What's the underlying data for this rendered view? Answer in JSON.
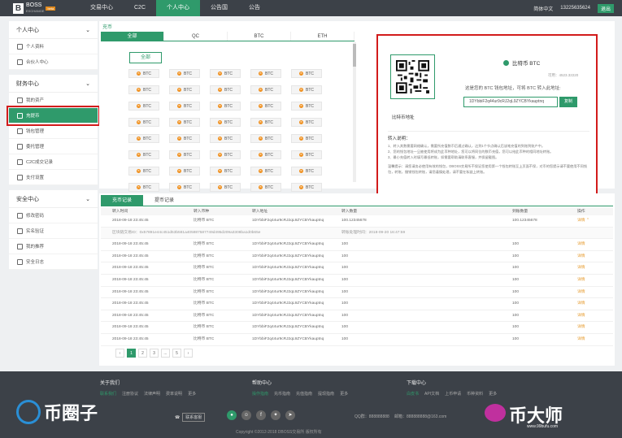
{
  "nav": {
    "logo_text": "BOSS",
    "logo_sub": "EXCHANGE",
    "logo_tag": "beta",
    "items": [
      "交易中心",
      "C2C",
      "个人中心",
      "公告国",
      "公告"
    ],
    "active_index": 2,
    "lang": "简体中文",
    "phone": "13225635624",
    "logout": "退出"
  },
  "sidebar": {
    "groups": [
      {
        "title": "个人中心",
        "items": [
          "个人资料",
          "合伙人中心"
        ]
      },
      {
        "title": "财务中心",
        "items": [
          "我的资产",
          "充提币",
          "钱包管理",
          "委托管理",
          "C2C成交记录",
          "支付设置"
        ],
        "active_index": 1
      },
      {
        "title": "安全中心",
        "items": [
          "修改密码",
          "实名验证",
          "我的推荐",
          "安全日志"
        ]
      }
    ]
  },
  "main": {
    "breadcrumb": "充币",
    "tabs": [
      "全部",
      "QC",
      "BTC",
      "ETH"
    ],
    "active_tab": 0,
    "all_button": "全部",
    "coins": [
      "BTC",
      "BTC",
      "BTC",
      "BTC",
      "BTC",
      "BTC",
      "BTC",
      "BTC",
      "BTC",
      "BTC",
      "BTC",
      "BTC",
      "BTC",
      "BTC",
      "BTC",
      "BTC",
      "BTC",
      "BTC",
      "BTC",
      "BTC",
      "BTC",
      "BTC",
      "BTC",
      "BTC",
      "BTC",
      "BTC",
      "BTC",
      "BTC",
      "BTC",
      "BTC",
      "BTC",
      "BTC",
      "BTC",
      "BTC",
      "BTC",
      "BTC",
      "BTC",
      "BTC",
      "BTC",
      "BTC"
    ]
  },
  "deposit": {
    "qr_caption": "比特币地址",
    "coin_name": "比特币 BTC",
    "available": "可用：4523.32220",
    "address_label": "这是您的 BTC 钱包地址，可将 BTC 转入此地址:",
    "address": "1DYbbiF2q44ur9cRJ2qL9ZYCBYkauptnq",
    "copy": "复制",
    "notes_title": "转入说明：",
    "notes": [
      "1、转入其数需要网络确认，需要所充值数币后通过确认，达到1个节点确认后该笔充值的到账到账户中。",
      "2、您的钱包地址一旦被使用将成为此币种地址，您可以将同位的数币充值，您可以给此币种的相同地址转账。",
      "3、最小充值转入时填写最低转账，如需要帮助请联系客服，并保留截图。"
    ],
    "warning": "温馨提示：请您请务必使用有效的钱包，DBOSS交易所不保证您使用第一个钱包转账至上页面不保，对币的您提示请不要使用不同钱包，转账，撤销钱包转账，请您谨慎处理，请不要在私链上转账。"
  },
  "records": {
    "tabs": [
      "充币记录",
      "提币记录"
    ],
    "active_tab": 0,
    "columns": [
      "转入时间",
      "转入币种",
      "转入地址",
      "转入数量",
      "到账数量",
      "操作"
    ],
    "rows": [
      {
        "time": "2018-09-18 23:45:45",
        "coin": "比特币 BTC",
        "addr": "1DYbbiF2q44ur9cRJ2qL9ZYCBYkauptnq",
        "amount": "100.12345678",
        "received": "100.12345678",
        "op": "详情 ⌃"
      },
      {
        "expanded": true,
        "txid_label": "区块链交易ID：0x57891e44c451d53b581a405987587749d495d209a3308ba1d0b65e",
        "confirm_label": "转账处理时间：2018-09-20 16:47:59"
      },
      {
        "time": "2018-09-18 23:45:45",
        "coin": "比特币 BTC",
        "addr": "1DYbbiF2q44ur9cRJ2qL9ZYCBYkauptnq",
        "amount": "100",
        "received": "100",
        "op": "详情"
      },
      {
        "time": "2018-09-18 23:45:45",
        "coin": "比特币 BTC",
        "addr": "1DYbbiF2q44ur9cRJ2qL9ZYCBYkauptnq",
        "amount": "100",
        "received": "100",
        "op": "详情"
      },
      {
        "time": "2018-09-18 23:45:45",
        "coin": "比特币 BTC",
        "addr": "1DYbbiF2q44ur9cRJ2qL9ZYCBYkauptnq",
        "amount": "100",
        "received": "100",
        "op": "详情"
      },
      {
        "time": "2018-09-18 23:45:45",
        "coin": "比特币 BTC",
        "addr": "1DYbbiF2q44ur9cRJ2qL9ZYCBYkauptnq",
        "amount": "100",
        "received": "100",
        "op": "详情"
      },
      {
        "time": "2018-09-18 23:45:45",
        "coin": "比特币 BTC",
        "addr": "1DYbbiF2q44ur9cRJ2qL9ZYCBYkauptnq",
        "amount": "100",
        "received": "100",
        "op": "详情"
      },
      {
        "time": "2018-09-18 23:45:45",
        "coin": "比特币 BTC",
        "addr": "1DYbbiF2q44ur9cRJ2qL9ZYCBYkauptnq",
        "amount": "100",
        "received": "100",
        "op": "详情"
      },
      {
        "time": "2018-09-18 23:45:45",
        "coin": "比特币 BTC",
        "addr": "1DYbbiF2q44ur9cRJ2qL9ZYCBYkauptnq",
        "amount": "100",
        "received": "100",
        "op": "详情"
      },
      {
        "time": "2018-09-18 23:45:45",
        "coin": "比特币 BTC",
        "addr": "1DYbbiF2q44ur9cRJ2qL9ZYCBYkauptnq",
        "amount": "100",
        "received": "100",
        "op": "详情"
      },
      {
        "time": "2018-09-18 23:45:45",
        "coin": "比特币 BTC",
        "addr": "1DYbbiF2q44ur9cRJ2qL9ZYCBYkauptnq",
        "amount": "100",
        "received": "100",
        "op": "详情"
      }
    ],
    "pager": [
      "‹",
      "1",
      "2",
      "3",
      "...",
      "5",
      "›"
    ],
    "pager_active": 1
  },
  "footer": {
    "cols": [
      {
        "title": "关于我们",
        "links": [
          "联系我们",
          "注册协议",
          "法律声明",
          "费率说明",
          "更多"
        ]
      },
      {
        "title": "帮助中心",
        "links": [
          "操作指南",
          "充币指南",
          "充值指南",
          "提现指南",
          "更多"
        ]
      },
      {
        "title": "下载中心",
        "links": [
          "白皮书",
          "API文档",
          "上币申请",
          "币种资料",
          "更多"
        ]
      }
    ],
    "contact": "联系客服",
    "qq": "QQ群：888888888",
    "email": "邮箱：888888888@163.com",
    "copyright": "Copyright ©2012-2018 DBOSS交易所 版权所有",
    "watermark_left": "币圈子",
    "watermark_right": "币大师",
    "watermark_right_sub": "www.99bufu.com"
  }
}
